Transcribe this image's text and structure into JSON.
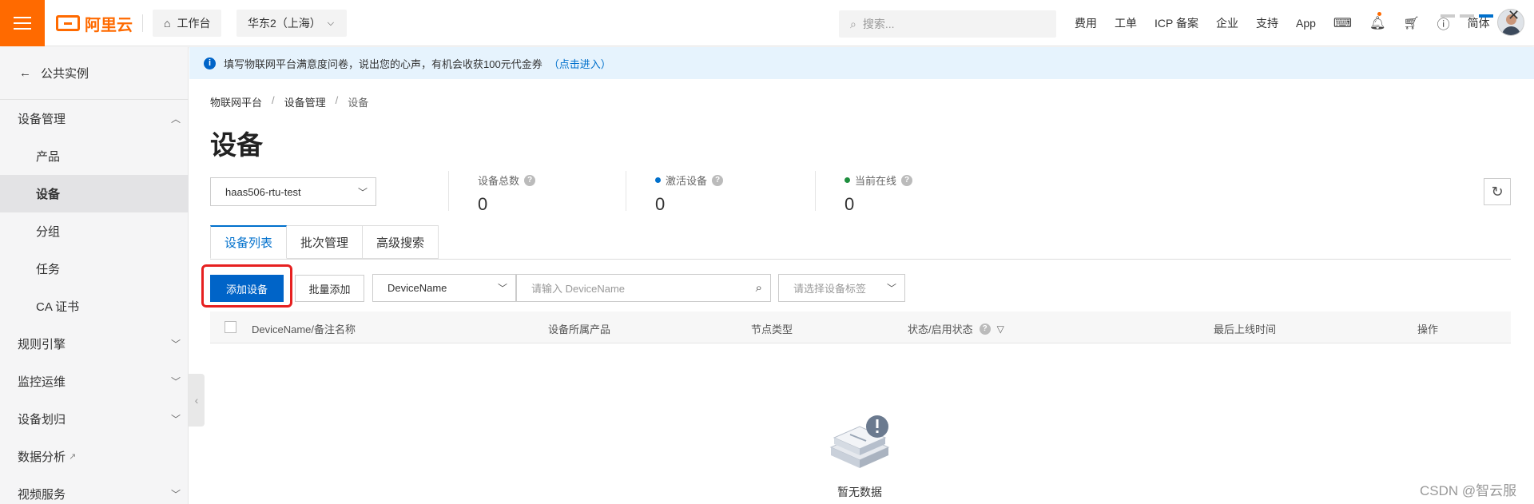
{
  "header": {
    "brand": "阿里云",
    "workbench_label": "工作台",
    "region_label": "华东2（上海）",
    "search_placeholder": "搜索...",
    "nav_links": [
      "费用",
      "工单",
      "ICP 备案",
      "企业",
      "支持",
      "App"
    ],
    "lang_label": "简体",
    "accent_color": "#ff6a00"
  },
  "sidebar": {
    "back_label": "公共实例",
    "items": [
      {
        "label": "设备管理",
        "type": "group",
        "chevron": "up"
      },
      {
        "label": "产品",
        "type": "sub"
      },
      {
        "label": "设备",
        "type": "sub",
        "active": true
      },
      {
        "label": "分组",
        "type": "sub"
      },
      {
        "label": "任务",
        "type": "sub"
      },
      {
        "label": "CA 证书",
        "type": "sub"
      },
      {
        "label": "规则引擎",
        "type": "group",
        "chevron": "down"
      },
      {
        "label": "监控运维",
        "type": "group",
        "chevron": "down"
      },
      {
        "label": "设备划归",
        "type": "group",
        "chevron": "down"
      },
      {
        "label": "数据分析",
        "type": "group",
        "external": true
      },
      {
        "label": "视频服务",
        "type": "group",
        "chevron": "down"
      }
    ]
  },
  "notice": {
    "text": "填写物联网平台满意度问卷，说出您的心声，有机会收获100元代金券",
    "link": "（点击进入）"
  },
  "breadcrumb": [
    "物联网平台",
    "设备管理",
    "设备"
  ],
  "page_title": "设备",
  "product_select": "haas506-rtu-test",
  "stats": [
    {
      "label": "设备总数",
      "value": "0",
      "dot": ""
    },
    {
      "label": "激活设备",
      "value": "0",
      "dot": "#0070cc"
    },
    {
      "label": "当前在线",
      "value": "0",
      "dot": "#1e8e3e"
    }
  ],
  "tabs": [
    "设备列表",
    "批次管理",
    "高级搜索"
  ],
  "toolbar": {
    "add_device": "添加设备",
    "batch_add": "批量添加",
    "field_select": "DeviceName",
    "search_placeholder": "请输入 DeviceName",
    "tag_select_placeholder": "请选择设备标签"
  },
  "table": {
    "columns": [
      "DeviceName/备注名称",
      "设备所属产品",
      "节点类型",
      "状态/启用状态",
      "最后上线时间",
      "操作"
    ]
  },
  "empty_text": "暂无数据",
  "watermark": "CSDN @智云服"
}
